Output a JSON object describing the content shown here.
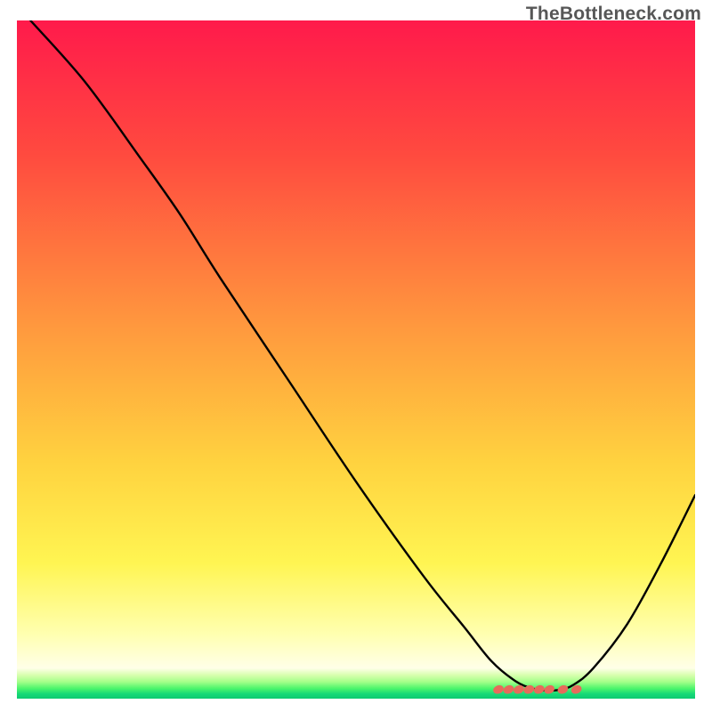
{
  "watermark": "TheBottleneck.com",
  "chart_data": {
    "type": "line",
    "title": "",
    "xlabel": "",
    "ylabel": "",
    "xlim": [
      0,
      100
    ],
    "ylim": [
      0,
      100
    ],
    "grid": false,
    "legend": false,
    "gradient_stops": [
      {
        "offset": 0.0,
        "color": "#ff1a4b"
      },
      {
        "offset": 0.2,
        "color": "#ff4b3f"
      },
      {
        "offset": 0.45,
        "color": "#ff983e"
      },
      {
        "offset": 0.65,
        "color": "#ffd23f"
      },
      {
        "offset": 0.8,
        "color": "#fff552"
      },
      {
        "offset": 0.905,
        "color": "#ffffb0"
      },
      {
        "offset": 0.955,
        "color": "#ffffe8"
      },
      {
        "offset": 0.965,
        "color": "#d9ffb0"
      },
      {
        "offset": 0.975,
        "color": "#a6ff8a"
      },
      {
        "offset": 0.985,
        "color": "#4cf56b"
      },
      {
        "offset": 0.993,
        "color": "#16d977"
      },
      {
        "offset": 1.0,
        "color": "#0ec971"
      }
    ],
    "series": [
      {
        "name": "curve",
        "type": "line",
        "x": [
          2,
          10,
          18,
          24,
          30,
          40,
          50,
          60,
          66,
          70,
          73.5,
          76,
          78,
          80,
          82,
          85,
          90,
          95,
          100
        ],
        "y": [
          100,
          91,
          80,
          71.5,
          62,
          47,
          32,
          18,
          10.5,
          5.5,
          2.6,
          1.5,
          1.2,
          1.3,
          2.0,
          4.5,
          11,
          20,
          30
        ]
      },
      {
        "name": "bottom-markers",
        "type": "scatter",
        "x": [
          71,
          72.5,
          74,
          75.5,
          77,
          78.5,
          80.5,
          82.5
        ],
        "y": [
          1.35,
          1.35,
          1.35,
          1.35,
          1.35,
          1.35,
          1.35,
          1.35
        ]
      }
    ]
  }
}
